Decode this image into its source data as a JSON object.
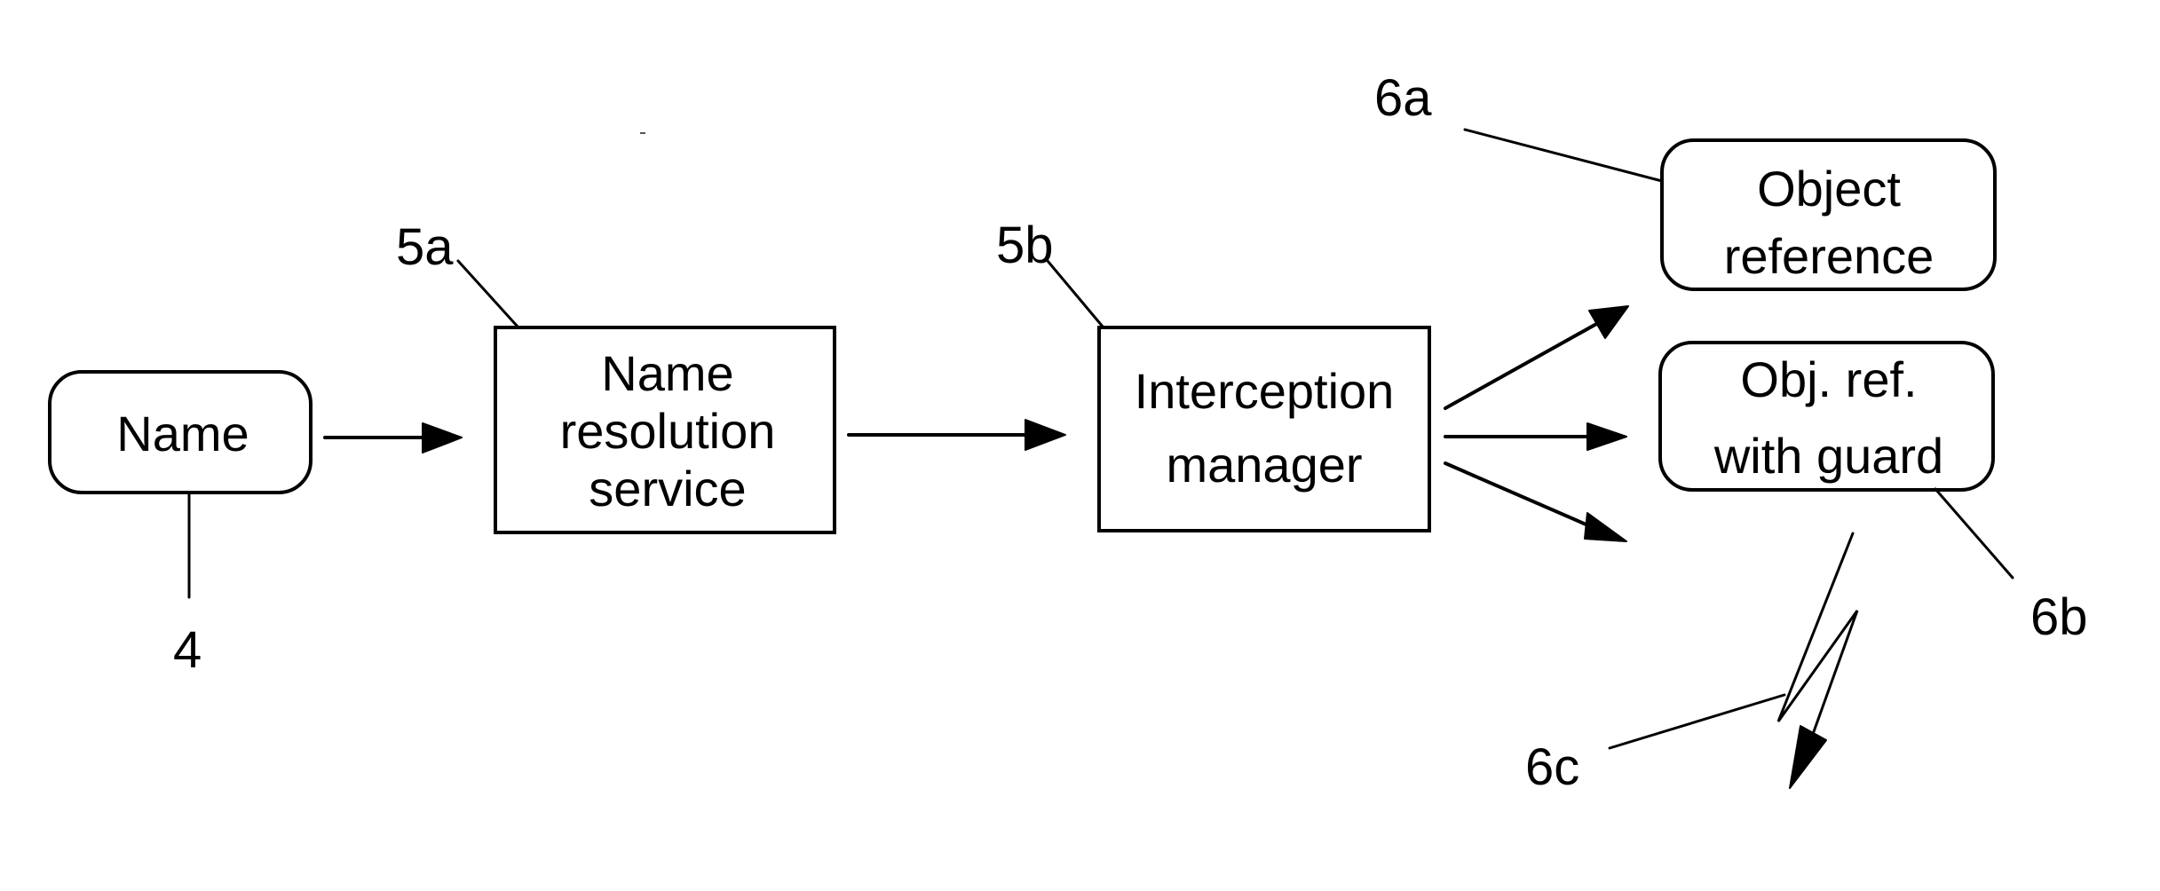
{
  "diagram": {
    "type": "flow",
    "nodes": [
      {
        "id": "name",
        "lines": [
          "Name"
        ],
        "shape": "rounded",
        "ref": "4"
      },
      {
        "id": "name-resolution-service",
        "lines": [
          "Name",
          "resolution",
          "service"
        ],
        "shape": "rectangle",
        "ref": "5a"
      },
      {
        "id": "interception-manager",
        "lines": [
          "Interception",
          "manager"
        ],
        "shape": "rectangle",
        "ref": "5b"
      },
      {
        "id": "object-reference",
        "lines": [
          "Object",
          "reference"
        ],
        "shape": "rounded",
        "ref": "6a"
      },
      {
        "id": "obj-ref-with-guard",
        "lines": [
          "Obj. ref.",
          "with guard"
        ],
        "shape": "rounded",
        "ref": "6b"
      },
      {
        "id": "exception",
        "lines": [],
        "shape": "lightning-arrow",
        "ref": "6c"
      }
    ],
    "edges": [
      {
        "from": "name",
        "to": "name-resolution-service"
      },
      {
        "from": "name-resolution-service",
        "to": "interception-manager"
      },
      {
        "from": "interception-manager",
        "to": "object-reference"
      },
      {
        "from": "interception-manager",
        "to": "obj-ref-with-guard"
      },
      {
        "from": "interception-manager",
        "to": "exception"
      }
    ],
    "ref_labels": {
      "r4": "4",
      "r5a": "5a",
      "r5b": "5b",
      "r6a": "6a",
      "r6b": "6b",
      "r6c": "6c"
    },
    "colors": {
      "stroke": "#000000",
      "background": "#ffffff"
    }
  }
}
